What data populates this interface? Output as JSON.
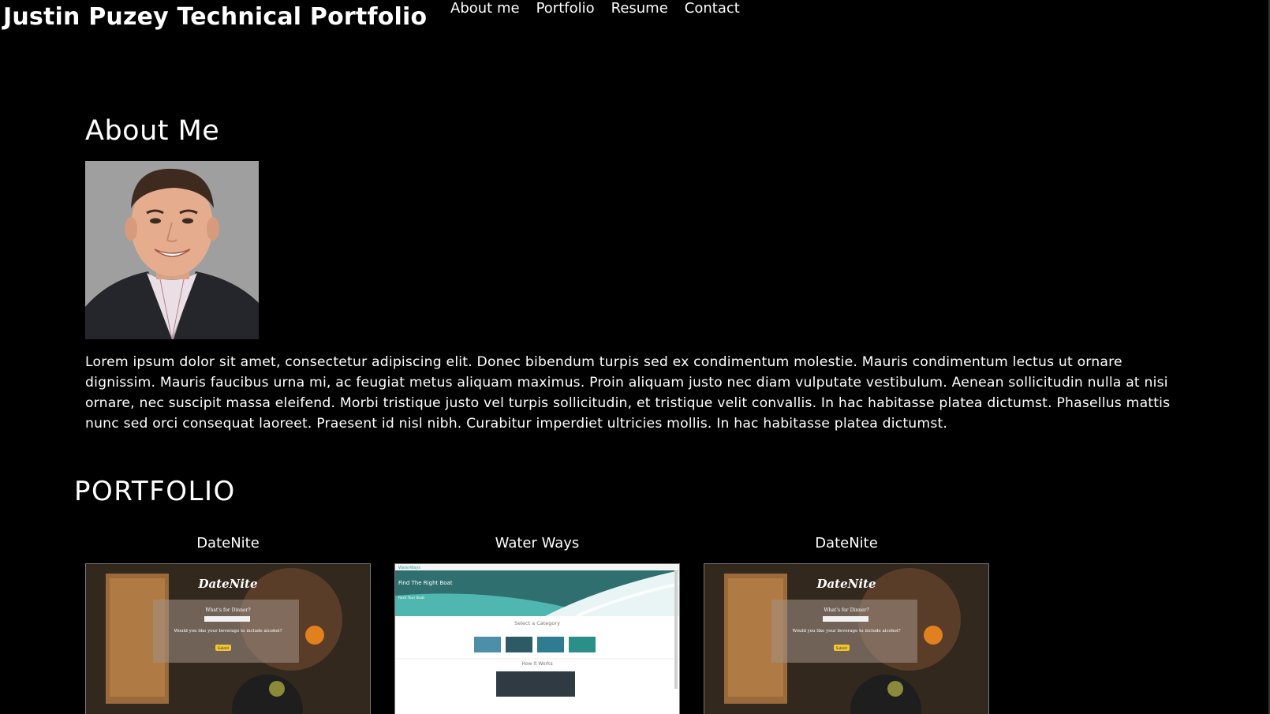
{
  "header": {
    "site_title": "Justin Puzey Technical Portfolio",
    "nav": [
      {
        "label": "About me"
      },
      {
        "label": "Portfolio"
      },
      {
        "label": "Resume"
      },
      {
        "label": "Contact"
      }
    ]
  },
  "about": {
    "heading": "About Me",
    "body": "Lorem ipsum dolor sit amet, consectetur adipiscing elit. Donec bibendum turpis sed ex condimentum molestie. Mauris condimentum lectus ut ornare dignissim. Mauris faucibus urna mi, ac feugiat metus aliquam maximus. Proin aliquam justo nec diam vulputate vestibulum. Aenean sollicitudin nulla at nisi ornare, nec suscipit massa eleifend. Morbi tristique justo vel turpis sollicitudin, et tristique velit convallis. In hac habitasse platea dictumst. Phasellus mattis nunc sed orci consequat laoreet. Praesent id nisl nibh. Curabitur imperdiet ultricies mollis. In hac habitasse platea dictumst."
  },
  "portfolio": {
    "heading": "PORTFOLIO",
    "projects": [
      {
        "title": "DateNite",
        "screenshot": {
          "logo": "DateNite",
          "prompt": "What's for Dinner?",
          "question": "Would you like your beverage to include alcohol?",
          "button": "Submit"
        }
      },
      {
        "title": "Water Ways",
        "screenshot": {
          "brand": "WaterWays",
          "hero": "Find The Right Boat",
          "subhead": "Rent Your Boat",
          "category_heading": "Select a Category",
          "how_heading": "How It Works"
        }
      },
      {
        "title": "DateNite",
        "screenshot": {
          "logo": "DateNite",
          "prompt": "What's for Dinner?",
          "question": "Would you like your beverage to include alcohol?",
          "button": "Submit"
        }
      }
    ]
  },
  "colors": {
    "background": "#000000",
    "text": "#ffffff",
    "accent_yellow": "#f2c531",
    "teal": "#3aa6a0"
  }
}
